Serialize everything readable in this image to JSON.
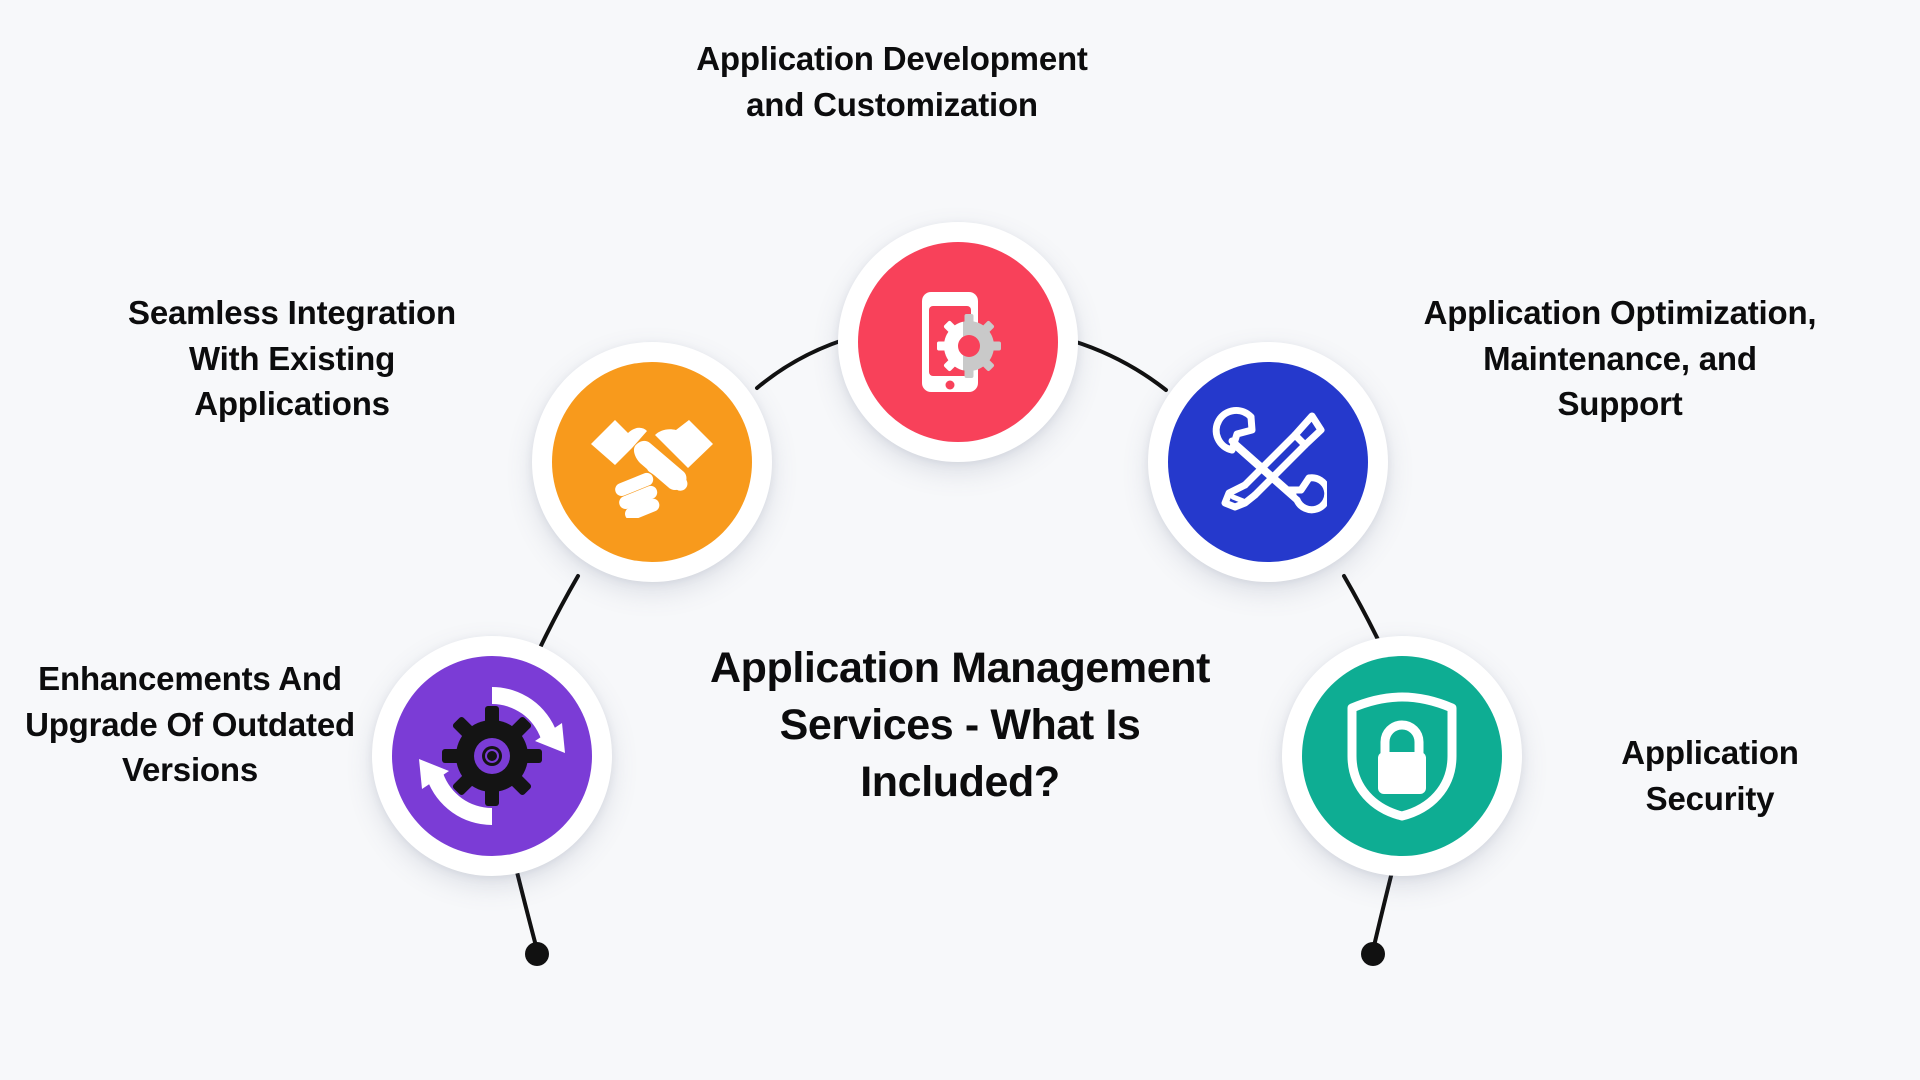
{
  "background_color": "#f7f8fa",
  "text_color": "#0c0c0d",
  "center": {
    "title": "Application Management Services - What Is Included?"
  },
  "nodes": [
    {
      "id": "dev",
      "label": "Application Development and Customization",
      "icon": "smartphone-gear-icon",
      "color": "#f8415a"
    },
    {
      "id": "integration",
      "label": "Seamless Integration With Existing Applications",
      "icon": "handshake-icon",
      "color": "#f89a1c"
    },
    {
      "id": "optimization",
      "label": "Application Optimization, Maintenance, and Support",
      "icon": "wrench-screwdriver-icon",
      "color": "#2539cc"
    },
    {
      "id": "upgrade",
      "label": "Enhancements And Upgrade Of Outdated Versions",
      "icon": "gear-refresh-icon",
      "color": "#7b3cd6"
    },
    {
      "id": "security",
      "label": "Application Security",
      "icon": "shield-lock-icon",
      "color": "#0ead93"
    }
  ],
  "connector_color": "#111111"
}
